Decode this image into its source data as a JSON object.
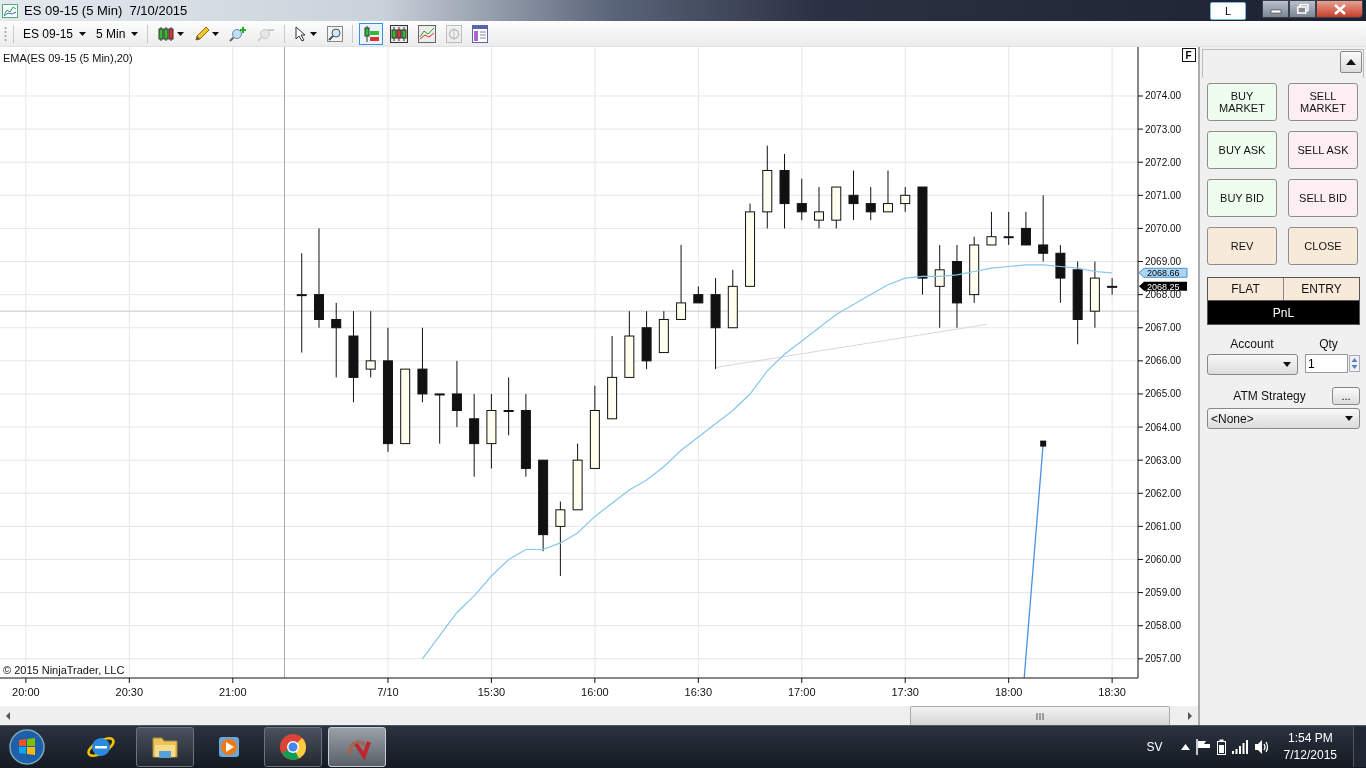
{
  "window": {
    "title": "ES 09-15 (5 Min)  7/10/2015",
    "link_button": "L"
  },
  "toolbar": {
    "instrument": "ES 09-15",
    "interval": "5 Min",
    "tools": [
      {
        "kind": "bar-style",
        "dropdown": true,
        "selected": false,
        "disabled": false
      },
      {
        "kind": "drawing",
        "dropdown": true,
        "selected": false,
        "disabled": false
      },
      {
        "kind": "zoom-in",
        "dropdown": false,
        "selected": false,
        "disabled": false
      },
      {
        "kind": "zoom-out",
        "dropdown": false,
        "selected": false,
        "disabled": true
      },
      {
        "kind": "pointer",
        "dropdown": true,
        "selected": false,
        "disabled": false
      },
      {
        "kind": "magnifier",
        "dropdown": false,
        "selected": false,
        "disabled": false
      },
      {
        "kind": "chart-trader",
        "dropdown": false,
        "selected": true,
        "disabled": false
      },
      {
        "kind": "data-box",
        "dropdown": false,
        "selected": false,
        "disabled": false
      },
      {
        "kind": "indicators",
        "dropdown": false,
        "selected": false,
        "disabled": false
      },
      {
        "kind": "strategies",
        "dropdown": false,
        "selected": false,
        "disabled": true
      },
      {
        "kind": "properties",
        "dropdown": false,
        "selected": false,
        "disabled": false
      }
    ]
  },
  "chart": {
    "f_button": "F",
    "copyright": "© 2015 NinjaTrader, LLC",
    "price_markers": [
      {
        "label": "2068.66",
        "kind": "ema"
      },
      {
        "label": "2068.25",
        "kind": "last"
      }
    ],
    "chart_data": {
      "type": "candlestick",
      "grid": true,
      "categories": [
        null,
        "20:00",
        null,
        null,
        null,
        null,
        null,
        "20:30",
        null,
        null,
        null,
        null,
        null,
        "21:00",
        null,
        null,
        null,
        null,
        null,
        null,
        null,
        null,
        "7/10",
        null,
        null,
        null,
        null,
        null,
        "15:30",
        null,
        null,
        null,
        null,
        null,
        "16:00",
        null,
        null,
        null,
        null,
        null,
        "16:30",
        null,
        null,
        null,
        null,
        null,
        "17:00",
        null,
        null,
        null,
        null,
        null,
        "17:30",
        null,
        null,
        null,
        null,
        null,
        "18:00",
        null,
        null,
        null,
        null,
        null,
        "18:30",
        null
      ],
      "ylim": [
        2056.42,
        2075.48
      ],
      "yticks": [
        {
          "value": 2057,
          "label": "2057.00"
        },
        {
          "value": 2058,
          "label": "2058.00"
        },
        {
          "value": 2059,
          "label": "2059.00"
        },
        {
          "value": 2060,
          "label": "2060.00"
        },
        {
          "value": 2061,
          "label": "2061.00"
        },
        {
          "value": 2062,
          "label": "2062.00"
        },
        {
          "value": 2063,
          "label": "2063.00"
        },
        {
          "value": 2064,
          "label": "2064.00"
        },
        {
          "value": 2065,
          "label": "2065.00"
        },
        {
          "value": 2066,
          "label": "2066.00"
        },
        {
          "value": 2067,
          "label": "2067.00"
        },
        {
          "value": 2068,
          "label": "2068.00"
        },
        {
          "value": 2069,
          "label": "2069.00"
        },
        {
          "value": 2070,
          "label": "2070.00"
        },
        {
          "value": 2071,
          "label": "2071.00"
        },
        {
          "value": 2072,
          "label": "2072.00"
        },
        {
          "value": 2073,
          "label": "2073.00"
        },
        {
          "value": 2074,
          "label": "2074.00"
        }
      ],
      "ohlc": [
        null,
        null,
        null,
        null,
        null,
        null,
        null,
        null,
        null,
        null,
        null,
        null,
        null,
        null,
        null,
        null,
        null,
        [
          2068.0,
          2069.25,
          2066.25,
          2068.0
        ],
        [
          2068.0,
          2070.0,
          2067.0,
          2067.25
        ],
        [
          2067.25,
          2067.75,
          2065.5,
          2067.0
        ],
        [
          2066.75,
          2067.5,
          2064.75,
          2065.5
        ],
        [
          2065.75,
          2067.5,
          2065.5,
          2066.0
        ],
        [
          2066.0,
          2067.0,
          2063.25,
          2063.5
        ],
        [
          2063.5,
          2065.75,
          2063.5,
          2065.75
        ],
        [
          2065.75,
          2067.0,
          2064.75,
          2065.0
        ],
        [
          2065.0,
          2065.0,
          2063.5,
          2065.0
        ],
        [
          2065.0,
          2066.0,
          2064.0,
          2064.5
        ],
        [
          2064.25,
          2065.0,
          2062.5,
          2063.5
        ],
        [
          2063.5,
          2065.0,
          2062.75,
          2064.5
        ],
        [
          2064.5,
          2065.5,
          2063.75,
          2064.5
        ],
        [
          2064.5,
          2065.0,
          2062.5,
          2062.75
        ],
        [
          2063.0,
          2063.0,
          2060.25,
          2060.75
        ],
        [
          2061.0,
          2061.75,
          2059.5,
          2061.5
        ],
        [
          2061.5,
          2063.5,
          2061.5,
          2063.0
        ],
        [
          2062.75,
          2065.25,
          2062.75,
          2064.5
        ],
        [
          2064.25,
          2066.75,
          2064.25,
          2065.5
        ],
        [
          2065.5,
          2067.5,
          2065.5,
          2066.75
        ],
        [
          2067.0,
          2067.5,
          2065.75,
          2066.0
        ],
        [
          2066.25,
          2067.5,
          2066.25,
          2067.25
        ],
        [
          2067.25,
          2069.5,
          2067.25,
          2067.75
        ],
        [
          2068.0,
          2068.25,
          2067.75,
          2067.75
        ],
        [
          2068.0,
          2068.5,
          2065.75,
          2067.0
        ],
        [
          2067.0,
          2068.75,
          2067.0,
          2068.25
        ],
        [
          2068.25,
          2070.75,
          2068.25,
          2070.5
        ],
        [
          2070.5,
          2072.5,
          2070.0,
          2071.75
        ],
        [
          2071.75,
          2072.25,
          2070.0,
          2070.75
        ],
        [
          2070.75,
          2071.5,
          2070.25,
          2070.5
        ],
        [
          2070.25,
          2071.25,
          2070.0,
          2070.5
        ],
        [
          2070.25,
          2071.25,
          2070.0,
          2071.25
        ],
        [
          2071.0,
          2071.75,
          2070.25,
          2070.75
        ],
        [
          2070.75,
          2071.25,
          2070.25,
          2070.5
        ],
        [
          2070.5,
          2071.75,
          2070.5,
          2070.75
        ],
        [
          2070.75,
          2071.25,
          2070.5,
          2071.0
        ],
        [
          2071.25,
          2071.25,
          2068.0,
          2068.5
        ],
        [
          2068.25,
          2069.5,
          2067.0,
          2068.75
        ],
        [
          2069.0,
          2069.5,
          2067.0,
          2067.75
        ],
        [
          2068.0,
          2069.75,
          2067.75,
          2069.5
        ],
        [
          2069.5,
          2070.5,
          2069.5,
          2069.75
        ],
        [
          2069.75,
          2070.5,
          2069.5,
          2069.75
        ],
        [
          2070.0,
          2070.5,
          2069.5,
          2069.5
        ],
        [
          2069.5,
          2071.0,
          2069.0,
          2069.25
        ],
        [
          2069.25,
          2069.5,
          2067.75,
          2068.5
        ],
        [
          2068.75,
          2069.0,
          2066.5,
          2067.25
        ],
        [
          2067.5,
          2069.0,
          2067.0,
          2068.5
        ],
        [
          2068.25,
          2068.5,
          2068.0,
          2068.25
        ],
        null
      ],
      "series": [
        {
          "name": "EMA(ES 09-15 (5 Min),20)",
          "type": "line",
          "color": "#87c6f0",
          "values": [
            null,
            null,
            null,
            null,
            null,
            null,
            null,
            null,
            null,
            null,
            null,
            null,
            null,
            null,
            null,
            null,
            null,
            null,
            null,
            null,
            null,
            null,
            null,
            null,
            2057.0,
            2057.7,
            2058.4,
            2058.9,
            2059.5,
            2060.0,
            2060.3,
            2060.3,
            2060.5,
            2060.8,
            2061.3,
            2061.7,
            2062.1,
            2062.4,
            2062.8,
            2063.3,
            2063.7,
            2064.1,
            2064.5,
            2065.0,
            2065.7,
            2066.2,
            2066.6,
            2067.0,
            2067.4,
            2067.7,
            2068.0,
            2068.3,
            2068.5,
            2068.55,
            2068.55,
            2068.6,
            2068.7,
            2068.8,
            2068.85,
            2068.9,
            2068.9,
            2068.85,
            2068.8,
            2068.7,
            2068.66,
            null
          ]
        }
      ],
      "ref_lines": [
        {
          "axis": "y",
          "value": 2067.5
        }
      ]
    }
  },
  "trade_panel": {
    "buttons": [
      {
        "label": "BUY MARKET",
        "kind": "buy"
      },
      {
        "label": "SELL MARKET",
        "kind": "sell"
      },
      {
        "label": "BUY ASK",
        "kind": "buy"
      },
      {
        "label": "SELL ASK",
        "kind": "sell"
      },
      {
        "label": "BUY BID",
        "kind": "buy"
      },
      {
        "label": "SELL BID",
        "kind": "sell"
      },
      {
        "label": "REV",
        "kind": "action"
      },
      {
        "label": "CLOSE",
        "kind": "action"
      }
    ],
    "position": {
      "status": "FLAT",
      "entry": "ENTRY",
      "pnl": "PnL"
    },
    "account": {
      "label": "Account"
    },
    "qty": {
      "label": "Qty",
      "value": "1"
    },
    "atm_strategy": {
      "label": "ATM Strategy",
      "more_button": "...",
      "value": "<None>"
    }
  },
  "taskbar": {
    "apps": [
      {
        "kind": "ie",
        "running": false,
        "selected": false
      },
      {
        "kind": "explorer",
        "running": true,
        "selected": false
      },
      {
        "kind": "media-player",
        "running": false,
        "selected": false
      },
      {
        "kind": "chrome",
        "running": true,
        "selected": false
      },
      {
        "kind": "ninjatrader",
        "running": true,
        "selected": true
      }
    ],
    "language": "SV",
    "time": "1:54 PM",
    "date": "7/12/2015"
  }
}
